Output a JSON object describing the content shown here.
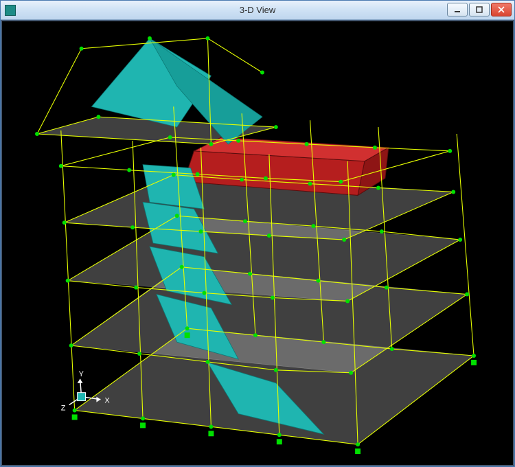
{
  "window": {
    "title": "3-D View",
    "icon_name": "app-icon"
  },
  "controls": {
    "minimize_icon": "minimize-icon",
    "maximize_icon": "maximize-icon",
    "close_icon": "close-icon"
  },
  "axes": {
    "x": "X",
    "y": "Y",
    "z": "Z"
  },
  "colors": {
    "frame_line": "#e6ff00",
    "node": "#00e000",
    "slab": "rgba(200,200,200,0.35)",
    "stair": "#1fb5b0",
    "wall": "#c02020",
    "background": "#000000"
  },
  "model": {
    "description": "Multi-story building wireframe with floor slabs, stair core, gable roof segment, and a red shear-wall box on the upper floor",
    "story_count": 5
  }
}
